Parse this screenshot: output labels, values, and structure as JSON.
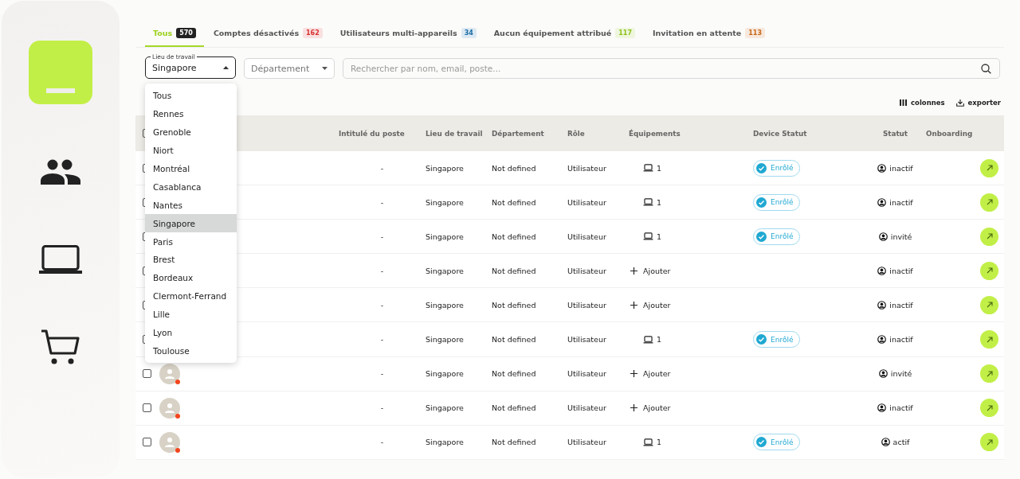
{
  "sidebar": {
    "items": [
      {
        "kind": "logo",
        "selected": true
      },
      {
        "kind": "people",
        "selected": false
      },
      {
        "kind": "laptop",
        "selected": false
      },
      {
        "kind": "cart",
        "selected": false
      }
    ]
  },
  "tabs": [
    {
      "label": "Tous",
      "count": "570",
      "color": "#222222",
      "selected": true
    },
    {
      "label": "Comptes désactivés",
      "count": "162",
      "color": "#d93030",
      "selected": false
    },
    {
      "label": "Utilisateurs multi-appareils",
      "count": "34",
      "color": "#1b6fa8",
      "selected": false
    },
    {
      "label": "Aucun équipement attribué",
      "count": "117",
      "color": "#8cc21a",
      "selected": false
    },
    {
      "label": "Invitation en attente",
      "count": "113",
      "color": "#c8681a",
      "selected": false
    }
  ],
  "filters": {
    "workplace": {
      "label": "Lieu de travail",
      "value": "Singapore",
      "expanded": true,
      "options": [
        {
          "label": "Tous",
          "selected": false
        },
        {
          "label": "Rennes",
          "selected": false
        },
        {
          "label": "Grenoble",
          "selected": false
        },
        {
          "label": "Niort",
          "selected": false
        },
        {
          "label": "Montréal",
          "selected": false
        },
        {
          "label": "Casablanca",
          "selected": false
        },
        {
          "label": "Nantes",
          "selected": false
        },
        {
          "label": "Singapore",
          "selected": true
        },
        {
          "label": "Paris",
          "selected": false
        },
        {
          "label": "Brest",
          "selected": false
        },
        {
          "label": "Bordeaux",
          "selected": false
        },
        {
          "label": "Clermont-Ferrand",
          "selected": false
        },
        {
          "label": "Lille",
          "selected": false
        },
        {
          "label": "Lyon",
          "selected": false
        },
        {
          "label": "Toulouse",
          "selected": false
        }
      ]
    },
    "department": {
      "placeholder": "Département"
    },
    "search": {
      "placeholder": "Rechercher par nom, email, poste..."
    }
  },
  "toolbar": {
    "columns": "colonnes",
    "export": "exporter"
  },
  "table": {
    "all_checked": false,
    "columns": [
      "Intitulé du poste",
      "Lieu de travail",
      "Département",
      "Rôle",
      "Équipements",
      "Device Statut",
      "Statut",
      "Onboarding"
    ],
    "rows": [
      {
        "checked": false,
        "job": "-",
        "workplace": "Singapore",
        "department": "Not defined",
        "role": "Utilisateur",
        "equipment": {
          "kind": "device",
          "count": "1"
        },
        "device_status": "Enrôlé",
        "status": "inactif"
      },
      {
        "checked": false,
        "job": "-",
        "workplace": "Singapore",
        "department": "Not defined",
        "role": "Utilisateur",
        "equipment": {
          "kind": "device",
          "count": "1"
        },
        "device_status": "Enrôlé",
        "status": "inactif"
      },
      {
        "checked": false,
        "job": "-",
        "workplace": "Singapore",
        "department": "Not defined",
        "role": "Utilisateur",
        "equipment": {
          "kind": "device",
          "count": "1"
        },
        "device_status": "Enrôlé",
        "status": "invité"
      },
      {
        "checked": false,
        "job": "-",
        "workplace": "Singapore",
        "department": "Not defined",
        "role": "Utilisateur",
        "equipment": {
          "kind": "add",
          "label": "Ajouter"
        },
        "status": "inactif"
      },
      {
        "checked": false,
        "job": "-",
        "workplace": "Singapore",
        "department": "Not defined",
        "role": "Utilisateur",
        "equipment": {
          "kind": "add",
          "label": "Ajouter"
        },
        "status": "inactif"
      },
      {
        "checked": false,
        "job": "-",
        "workplace": "Singapore",
        "department": "Not defined",
        "role": "Utilisateur",
        "equipment": {
          "kind": "device",
          "count": "1"
        },
        "device_status": "Enrôlé",
        "status": "inactif"
      },
      {
        "checked": false,
        "job": "-",
        "workplace": "Singapore",
        "department": "Not defined",
        "role": "Utilisateur",
        "equipment": {
          "kind": "add",
          "label": "Ajouter"
        },
        "status": "invité",
        "avatar": true
      },
      {
        "checked": false,
        "job": "-",
        "workplace": "Singapore",
        "department": "Not defined",
        "role": "Utilisateur",
        "equipment": {
          "kind": "add",
          "label": "Ajouter"
        },
        "status": "inactif",
        "avatar": true
      },
      {
        "checked": false,
        "avatar": true,
        "job": "-",
        "workplace": "Singapore",
        "department": "Not defined",
        "role": "Utilisateur",
        "equipment": {
          "kind": "device",
          "count": "1"
        },
        "device_status": "Enrôlé",
        "status": "actif"
      }
    ]
  }
}
